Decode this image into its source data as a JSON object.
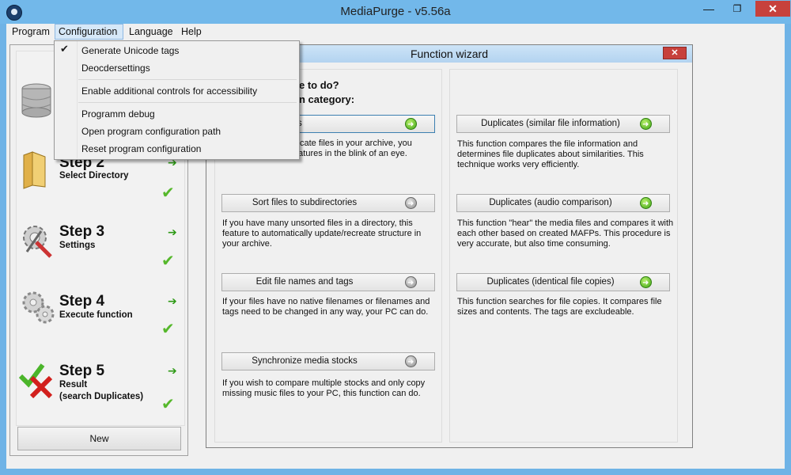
{
  "window": {
    "title": "MediaPurge - v5.56a",
    "minimize": "—",
    "maximize": "❐",
    "close": "✕"
  },
  "menubar": [
    "Program",
    "Configuration",
    "Language",
    "Help"
  ],
  "configuration_menu": {
    "items": [
      {
        "label": "Generate Unicode tags",
        "checked": true
      },
      {
        "label": "Deocdersettings"
      },
      {
        "label": "Enable additional controls for accessibility"
      },
      {
        "label": "Programm debug"
      },
      {
        "label": "Open program configuration path"
      },
      {
        "label": "Reset program configuration"
      }
    ]
  },
  "steps": [
    {
      "title": "Step 2",
      "subtitle": "Select Directory",
      "icon": "folder-icon"
    },
    {
      "title": "Step 3",
      "subtitle": "Settings",
      "icon": "settings-tools-icon"
    },
    {
      "title": "Step 4",
      "subtitle": "Execute function",
      "icon": "gears-icon"
    },
    {
      "title": "Step 5",
      "subtitle": "Result\n(search Duplicates)",
      "icon": "check-cross-icon"
    }
  ],
  "new_button": "New",
  "wizard": {
    "title": "Function wizard",
    "close": "✕",
    "question_line1": "e to do?",
    "question_line2": "n category:",
    "left_column": [
      {
        "button": "s",
        "desc": "plicate files in your archive, you\nfeatures in the blink of an eye.",
        "arrow": "green"
      },
      {
        "button": "Sort files to subdirectories",
        "desc": "If you have many unsorted files in a directory, this\nfeature to automatically update/recreate structure in\nyour archive.",
        "arrow": "grey"
      },
      {
        "button": "Edit file names and tags",
        "desc": "If your files have no native filenames or filenames and\ntags need to be changed in any way, your PC can do.",
        "arrow": "grey"
      },
      {
        "button": "Synchronize media stocks",
        "desc": "If you wish to compare multiple stocks and only copy\nmissing music files to your PC, this function can do.",
        "arrow": "grey"
      }
    ],
    "right_column": [
      {
        "button": "Duplicates (similar file information)",
        "desc": "This function compares the file information and\ndetermines file duplicates about similarities. This\ntechnique works very efficiently.",
        "arrow": "green"
      },
      {
        "button": "Duplicates (audio comparison)",
        "desc": "This function \"hear\" the media files and compares it with\neach other based on created MAFPs. This procedure is\nvery accurate, but also time consuming.",
        "arrow": "green"
      },
      {
        "button": "Duplicates (identical file copies)",
        "desc": "This function searches for file copies. It compares file\nsizes and contents. The tags are excludeable.",
        "arrow": "green"
      }
    ]
  },
  "colors": {
    "titlebar": "#72b8ea",
    "close": "#c7413c",
    "accent_green": "#3ea414"
  }
}
